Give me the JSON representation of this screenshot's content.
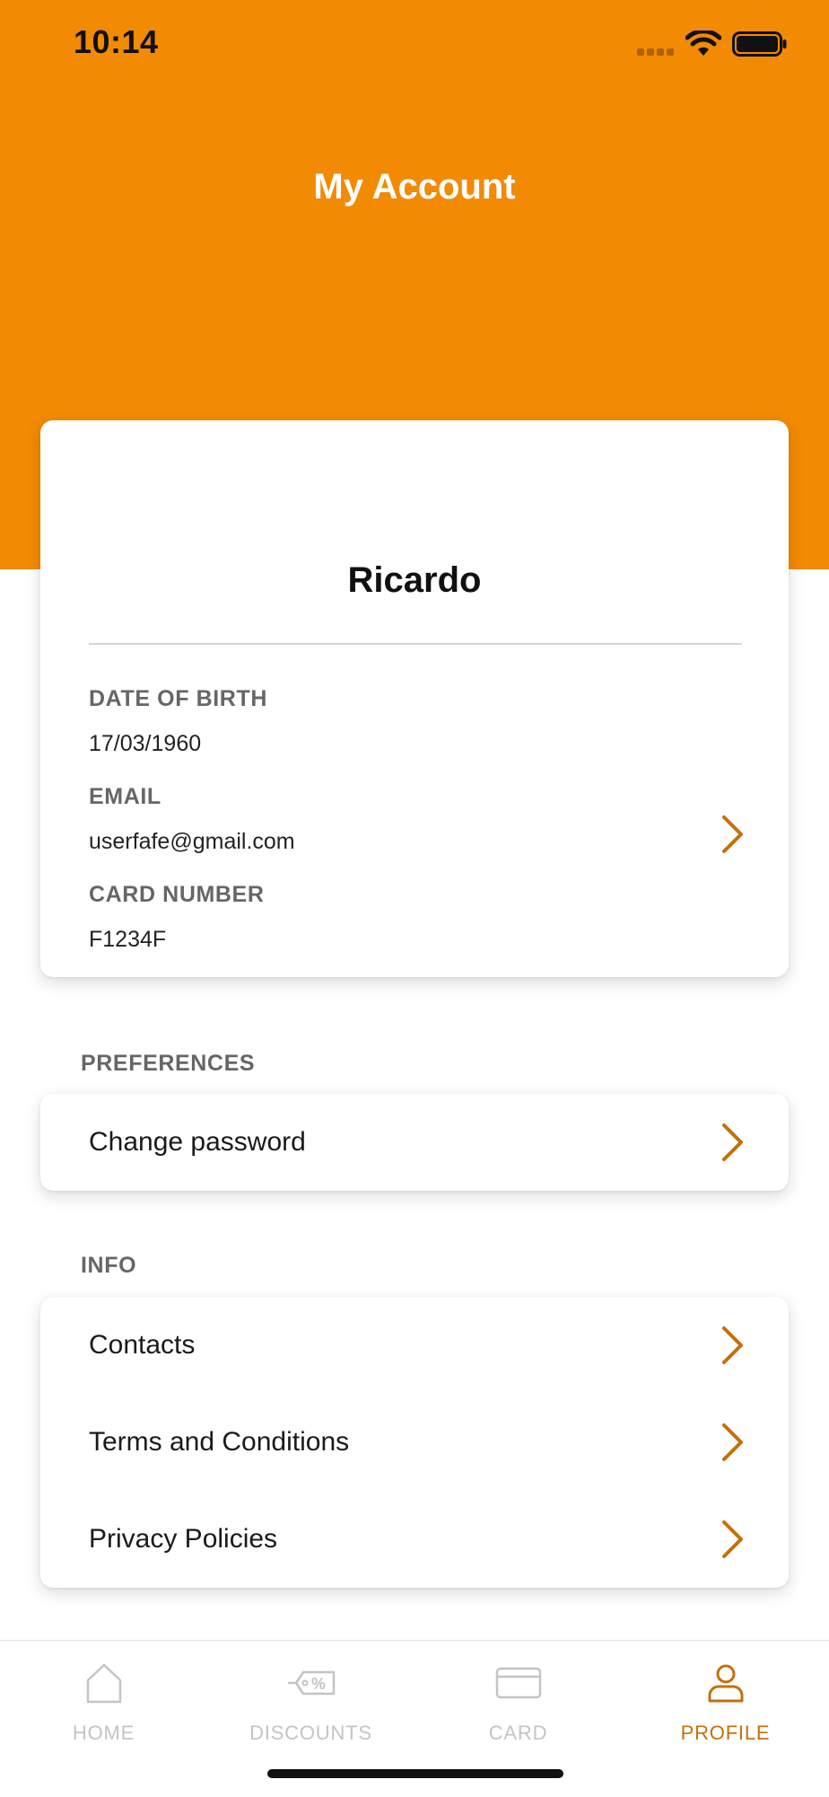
{
  "status_bar": {
    "time": "10:14"
  },
  "header": {
    "title": "My Account"
  },
  "profile": {
    "name": "Ricardo",
    "fields": [
      {
        "label": "DATE OF BIRTH",
        "value": "17/03/1960"
      },
      {
        "label": "EMAIL",
        "value": "userfafe@gmail.com"
      },
      {
        "label": "CARD NUMBER",
        "value": "F1234F"
      }
    ]
  },
  "sections": {
    "preferences": {
      "label": "PREFERENCES",
      "items": [
        {
          "label": "Change password"
        }
      ]
    },
    "info": {
      "label": "INFO",
      "items": [
        {
          "label": "Contacts"
        },
        {
          "label": "Terms and Conditions"
        },
        {
          "label": "Privacy Policies"
        }
      ]
    }
  },
  "tabbar": {
    "tabs": [
      {
        "label": "HOME",
        "icon": "home-icon",
        "active": false
      },
      {
        "label": "DISCOUNTS",
        "icon": "discount-tag-icon",
        "active": false
      },
      {
        "label": "CARD",
        "icon": "card-icon",
        "active": false
      },
      {
        "label": "PROFILE",
        "icon": "profile-icon",
        "active": true
      }
    ]
  },
  "colors": {
    "header_orange": "#F28A03",
    "accent": "#C4700A",
    "inactive_tab": "#C4C4C4"
  }
}
